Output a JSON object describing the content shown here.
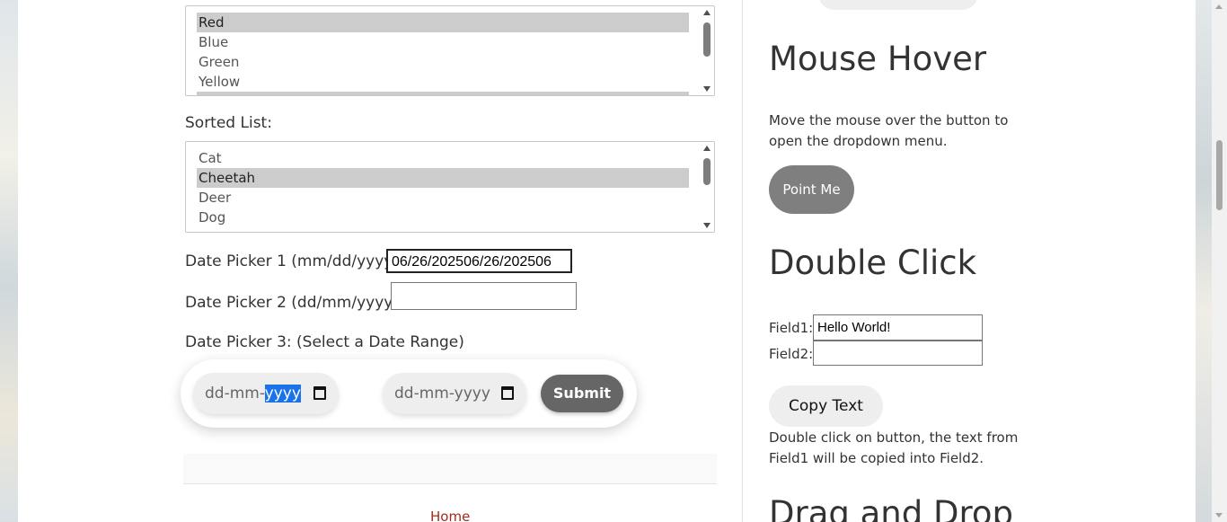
{
  "colors_list": {
    "options": [
      "Red",
      "Blue",
      "Green",
      "Yellow"
    ],
    "selected": [
      "Red"
    ]
  },
  "sorted_list": {
    "label": "Sorted List:",
    "options": [
      "Cat",
      "Cheetah",
      "Deer",
      "Dog"
    ],
    "selected": [
      "Cheetah"
    ]
  },
  "date_picker_1": {
    "label": "Date Picker 1 (mm/dd/yyyy):",
    "value": "06/26/202506/26/202506"
  },
  "date_picker_2": {
    "label": "Date Picker 2 (dd/mm/yyyy) :",
    "value": ""
  },
  "date_picker_3": {
    "label": "Date Picker 3: (Select a Date Range)",
    "start_prefix": "dd-mm-",
    "start_highlight": "yyyy",
    "end_placeholder": "dd-mm-yyyy",
    "submit_label": "Submit"
  },
  "footer": {
    "home_link": "Home"
  },
  "mouse_hover": {
    "title": "Mouse Hover",
    "description": "Move the mouse over the button to open the dropdown menu.",
    "button_label": "Point Me"
  },
  "double_click": {
    "title": "Double Click",
    "field1_label": "Field1:",
    "field1_value": "Hello World!",
    "field2_label": "Field2:",
    "field2_value": "",
    "button_label": "Copy Text",
    "description": "Double click on button, the text from Field1 will be copied into Field2."
  },
  "drag_and_drop": {
    "title": "Drag and Drop"
  },
  "icons": [
    "calendar-icon",
    "scroll-up-arrow-icon",
    "scroll-down-arrow-icon"
  ],
  "accent_colors": {
    "link": "#a32c1a",
    "selection_highlight": "#1a73e8",
    "submit_button": "#666666",
    "point_me_button": "#7f7f7f"
  }
}
